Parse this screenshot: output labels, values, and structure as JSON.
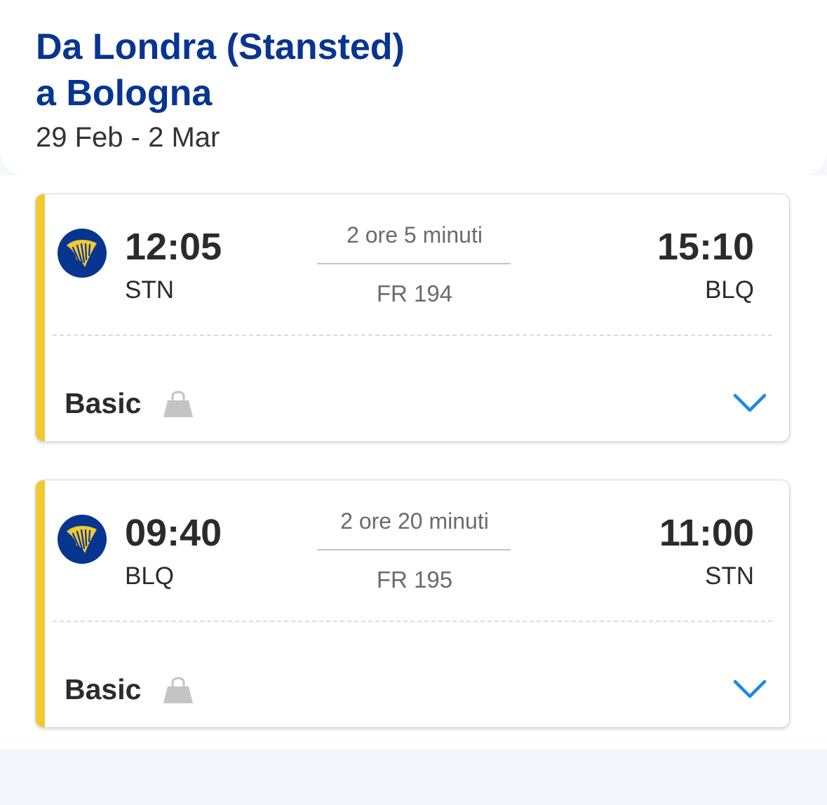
{
  "header": {
    "title_line1": "Da Londra (Stansted)",
    "title_line2": "a Bologna",
    "dates": "29 Feb - 2 Mar"
  },
  "flights": [
    {
      "departure_time": "12:05",
      "departure_airport": "STN",
      "duration": "2 ore 5 minuti",
      "flight_number": "FR 194",
      "arrival_time": "15:10",
      "arrival_airport": "BLQ",
      "fare": "Basic"
    },
    {
      "departure_time": "09:40",
      "departure_airport": "BLQ",
      "duration": "2 ore 20 minuti",
      "flight_number": "FR 195",
      "arrival_time": "11:00",
      "arrival_airport": "STN",
      "fare": "Basic"
    }
  ],
  "icons": {
    "airline_logo": "ryanair-harp-icon",
    "fare_bag": "handbag-icon",
    "expand": "chevron-down-icon"
  },
  "colors": {
    "brand_blue": "#073590",
    "accent_yellow": "#f1c933",
    "chevron_blue": "#1e88e5",
    "page_background": "#f4f7fc"
  }
}
